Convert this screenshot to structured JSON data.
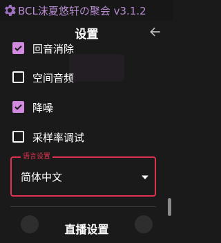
{
  "window": {
    "title": "BCL沫夏悠轩の聚会 v3.1.2"
  },
  "header": {
    "page_title": "设置"
  },
  "options": [
    {
      "label": "回音消除",
      "checked": true
    },
    {
      "label": "空间音频",
      "checked": false
    },
    {
      "label": "降噪",
      "checked": true
    },
    {
      "label": "采样率调试",
      "checked": false
    }
  ],
  "language": {
    "legend": "语言设置",
    "value": "简体中文"
  },
  "section": {
    "title": "直播设置"
  },
  "colors": {
    "accent": "#d28ae0",
    "title_purple": "#b78cd0",
    "focus_red": "#e0314f",
    "background": "#1a1a1a"
  }
}
